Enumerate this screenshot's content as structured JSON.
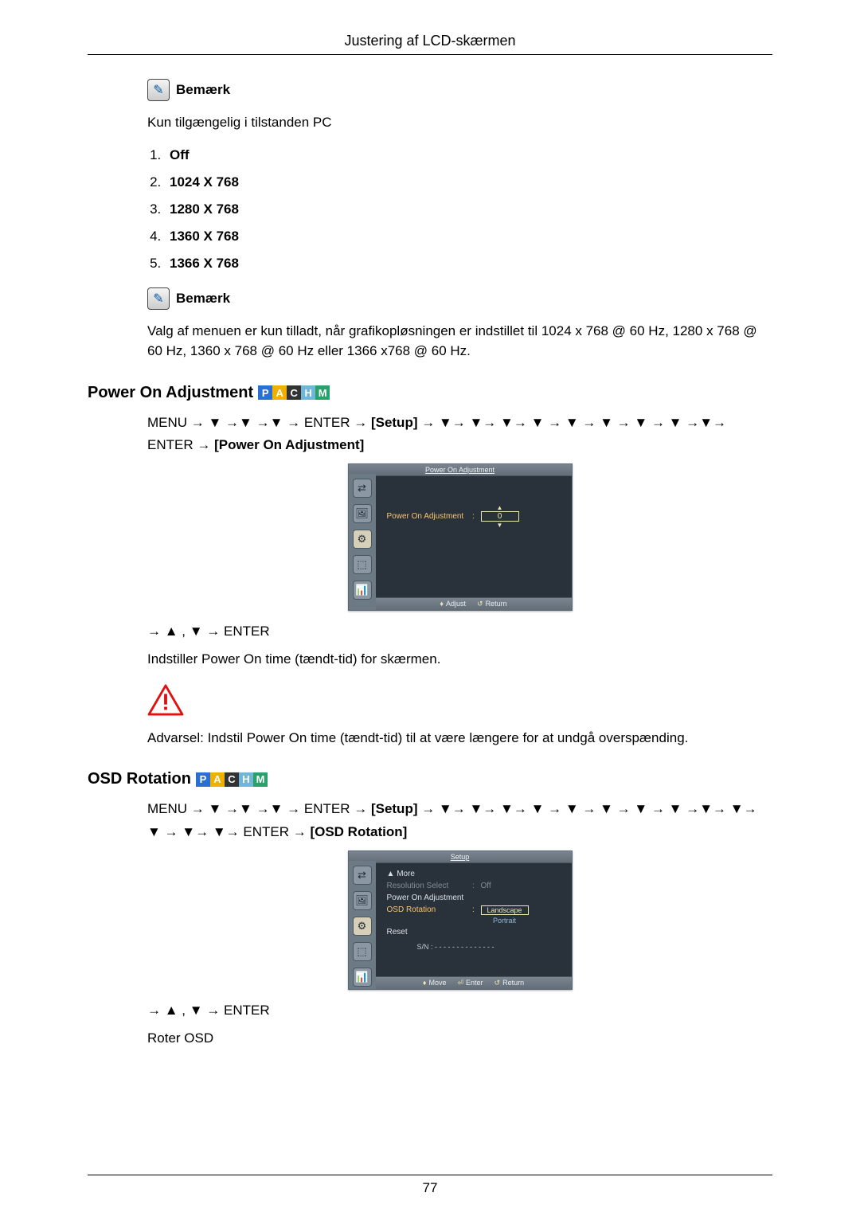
{
  "header": {
    "title": "Justering af LCD-skærmen"
  },
  "note_label": "Bemærk",
  "intro_text": "Kun tilgængelig i tilstanden PC",
  "resolutions": [
    "Off",
    "1024 X 768",
    "1280 X 768",
    "1360 X 768",
    "1366 X 768"
  ],
  "note2_text": "Valg af menuen er kun tilladt, når grafikopløsningen er indstillet til 1024 x 768 @ 60 Hz, 1280 x 768 @ 60 Hz, 1360 x 768 @ 60 Hz eller 1366 x768 @ 60 Hz.",
  "sections": {
    "power_on": {
      "title": "Power On Adjustment",
      "path_prefix": "MENU → ▼ →▼ →▼ → ENTER → ",
      "path_setup": "[Setup]",
      "path_mid": " → ▼→ ▼→ ▼→ ▼ → ▼ → ▼ → ▼ → ▼ →▼→ ENTER → ",
      "path_target": "[Power On Adjustment]",
      "action": "→ ▲ , ▼ → ENTER",
      "desc": "Indstiller Power On time (tændt-tid) for skærmen.",
      "warning": "Advarsel: Indstil Power On time (tændt-tid) til at være længere for at undgå overspænding."
    },
    "osd_rotation": {
      "title": "OSD Rotation",
      "path_prefix": "MENU → ▼ →▼ →▼ → ENTER → ",
      "path_setup": "[Setup]",
      "path_mid": " → ▼→ ▼→ ▼→ ▼ → ▼ → ▼ → ▼ → ▼ →▼→ ▼→ ▼ → ▼→ ▼→ ENTER → ",
      "path_target": "[OSD Rotation]",
      "action": "→ ▲ , ▼ → ENTER",
      "desc": "Roter OSD"
    }
  },
  "osd1": {
    "title": "Power On Adjustment",
    "row_label": "Power On Adjustment",
    "value": "0",
    "footer_adjust": "Adjust",
    "footer_return": "Return"
  },
  "osd2": {
    "title": "Setup",
    "more": "More",
    "rows": {
      "res_sel": {
        "label": "Resolution Select",
        "value": "Off"
      },
      "poa": {
        "label": "Power On Adjustment"
      },
      "osd_rot": {
        "label": "OSD Rotation",
        "opt1": "Landscape",
        "opt2": "Portrait"
      },
      "reset": {
        "label": "Reset"
      }
    },
    "sn": "S/N : - - - - - - - - - - - - - -",
    "footer_move": "Move",
    "footer_enter": "Enter",
    "footer_return": "Return"
  },
  "modes": [
    "P",
    "A",
    "C",
    "H",
    "M"
  ],
  "page_number": "77"
}
